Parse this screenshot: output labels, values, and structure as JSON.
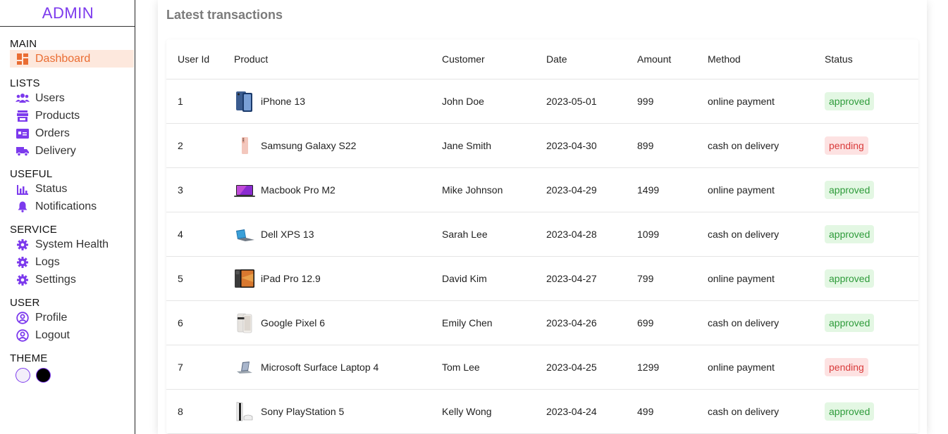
{
  "brand": {
    "logo": "ADMIN",
    "color": "#7c3aed"
  },
  "sidebar": {
    "sections": [
      {
        "title": "MAIN",
        "items": [
          {
            "label": "Dashboard",
            "icon": "dashboard-icon",
            "active": true
          }
        ]
      },
      {
        "title": "LISTS",
        "items": [
          {
            "label": "Users",
            "icon": "users-icon"
          },
          {
            "label": "Products",
            "icon": "store-icon"
          },
          {
            "label": "Orders",
            "icon": "credit-card-icon"
          },
          {
            "label": "Delivery",
            "icon": "truck-icon"
          }
        ]
      },
      {
        "title": "USEFUL",
        "items": [
          {
            "label": "Status",
            "icon": "bar-chart-icon"
          },
          {
            "label": "Notifications",
            "icon": "bell-icon"
          }
        ]
      },
      {
        "title": "SERVICE",
        "items": [
          {
            "label": "System Health",
            "icon": "gear-icon"
          },
          {
            "label": "Logs",
            "icon": "gear-icon"
          },
          {
            "label": "Settings",
            "icon": "gear-icon"
          }
        ]
      },
      {
        "title": "USER",
        "items": [
          {
            "label": "Profile",
            "icon": "user-circle-icon"
          },
          {
            "label": "Logout",
            "icon": "user-circle-icon"
          }
        ]
      }
    ],
    "theme": {
      "title": "THEME",
      "options": [
        {
          "name": "light",
          "color": "#f3effa"
        },
        {
          "name": "dark",
          "color": "#000000"
        }
      ]
    }
  },
  "main": {
    "title": "Latest transactions",
    "table": {
      "headers": [
        "User Id",
        "Product",
        "Customer",
        "Date",
        "Amount",
        "Method",
        "Status"
      ],
      "rows": [
        {
          "id": "1",
          "product": "iPhone 13",
          "thumb": "iphone-image",
          "customer": "John Doe",
          "date": "2023-05-01",
          "amount": "999",
          "method": "online payment",
          "status": "approved"
        },
        {
          "id": "2",
          "product": "Samsung Galaxy S22",
          "thumb": "galaxy-image",
          "customer": "Jane Smith",
          "date": "2023-04-30",
          "amount": "899",
          "method": "cash on delivery",
          "status": "pending"
        },
        {
          "id": "3",
          "product": "Macbook Pro M2",
          "thumb": "macbook-image",
          "customer": "Mike Johnson",
          "date": "2023-04-29",
          "amount": "1499",
          "method": "online payment",
          "status": "approved"
        },
        {
          "id": "4",
          "product": "Dell XPS 13",
          "thumb": "dell-laptop-image",
          "customer": "Sarah Lee",
          "date": "2023-04-28",
          "amount": "1099",
          "method": "cash on delivery",
          "status": "approved"
        },
        {
          "id": "5",
          "product": "iPad Pro 12.9",
          "thumb": "ipad-image",
          "customer": "David Kim",
          "date": "2023-04-27",
          "amount": "799",
          "method": "online payment",
          "status": "approved"
        },
        {
          "id": "6",
          "product": "Google Pixel 6",
          "thumb": "pixel-image",
          "customer": "Emily Chen",
          "date": "2023-04-26",
          "amount": "699",
          "method": "cash on delivery",
          "status": "approved"
        },
        {
          "id": "7",
          "product": "Microsoft Surface Laptop 4",
          "thumb": "surface-image",
          "customer": "Tom Lee",
          "date": "2023-04-25",
          "amount": "1299",
          "method": "online payment",
          "status": "pending"
        },
        {
          "id": "8",
          "product": "Sony PlayStation 5",
          "thumb": "ps5-image",
          "customer": "Kelly Wong",
          "date": "2023-04-24",
          "amount": "499",
          "method": "cash on delivery",
          "status": "approved"
        }
      ]
    }
  },
  "colors": {
    "accent": "#7c3aed",
    "active_bg": "#fde8dd",
    "active_text": "#ea6d33",
    "approved_bg": "#e3f7e3",
    "approved_text": "#2e9b3a",
    "pending_bg": "#fde2e2",
    "pending_text": "#d93b3b"
  }
}
